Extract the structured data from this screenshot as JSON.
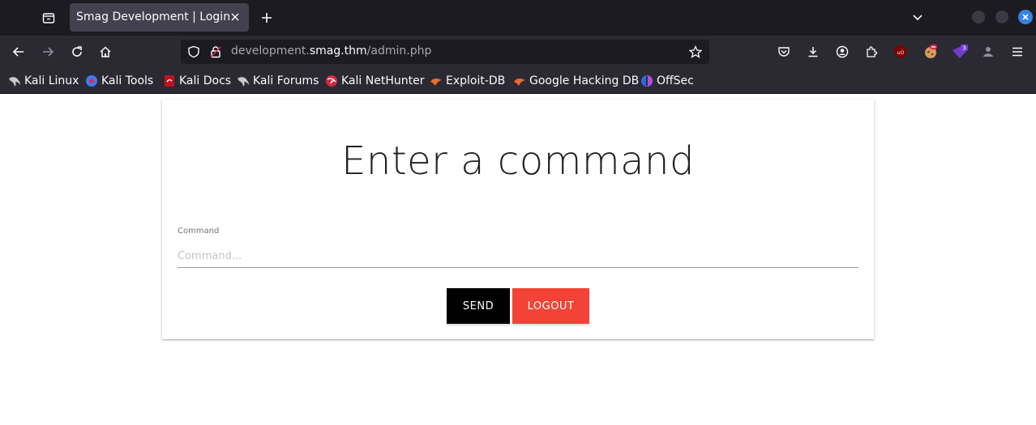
{
  "browser": {
    "tab_title": "Smag Development | Login",
    "url": {
      "prefix": "development.",
      "host": "smag.thm",
      "path": "/admin.php"
    },
    "extension_badge": "3",
    "bookmarks": [
      {
        "label": "Kali Linux",
        "icon": "kali-dragon-icon"
      },
      {
        "label": "Kali Tools",
        "icon": "kali-tools-icon"
      },
      {
        "label": "Kali Docs",
        "icon": "kali-docs-icon"
      },
      {
        "label": "Kali Forums",
        "icon": "kali-dragon-icon"
      },
      {
        "label": "Kali NetHunter",
        "icon": "nethunter-icon"
      },
      {
        "label": "Exploit-DB",
        "icon": "exploit-db-icon"
      },
      {
        "label": "Google Hacking DB",
        "icon": "exploit-db-icon"
      },
      {
        "label": "OffSec",
        "icon": "offsec-icon"
      }
    ]
  },
  "page": {
    "heading": "Enter a command",
    "command_label": "Command",
    "command_placeholder": "Command...",
    "command_value": "",
    "send_label": "SEND",
    "logout_label": "LOGOUT"
  },
  "colors": {
    "send_button": "#000000",
    "logout_button": "#f44336"
  }
}
